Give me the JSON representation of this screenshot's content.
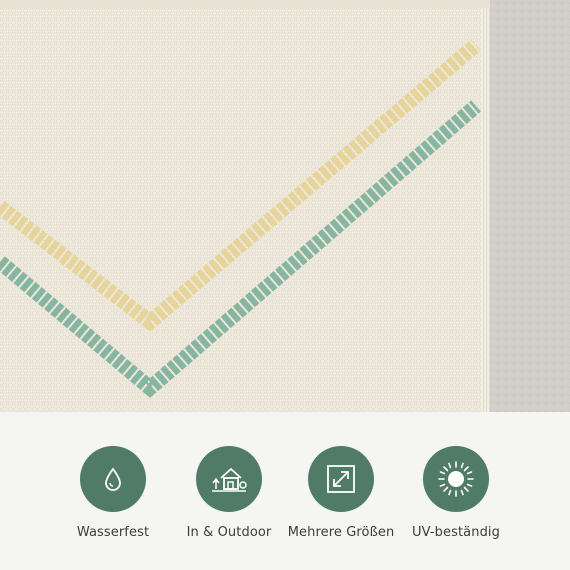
{
  "photo": {
    "subject": "rug-corner-closeup"
  },
  "features": [
    {
      "icon": "water-drop-icon",
      "label": "Wasserfest"
    },
    {
      "icon": "house-garden-icon",
      "label": "In & Outdoor"
    },
    {
      "icon": "resize-arrows-icon",
      "label": "Mehrere Größen"
    },
    {
      "icon": "sun-icon",
      "label": "UV-beständig"
    }
  ],
  "colors": {
    "icon_circle": "#4f7b67",
    "rug_base": "#efeadd",
    "stripe_yellow": "#e7d49a",
    "stripe_mint": "#86b5a1",
    "floor": "#d3d0cc"
  }
}
